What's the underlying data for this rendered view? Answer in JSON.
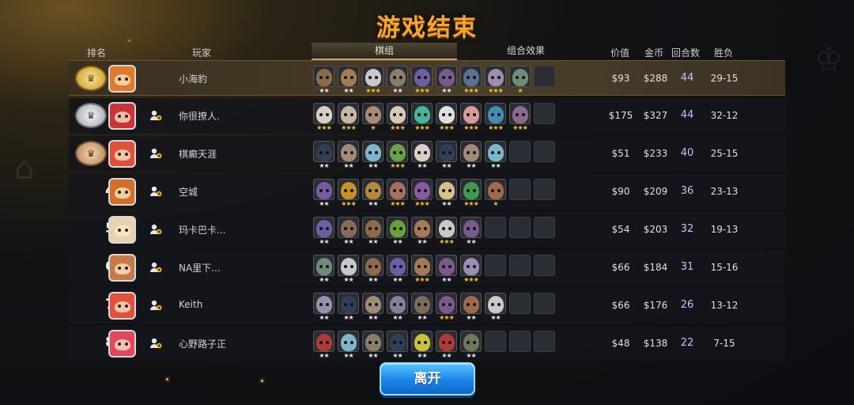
{
  "title": "游戏结束",
  "headers": {
    "rank": "排名",
    "player": "玩家",
    "pieces_tab": "棋组",
    "synergy_tab": "组合效果",
    "value": "价值",
    "gold": "金币",
    "rounds": "回合数",
    "record": "胜负"
  },
  "leave_button": "离开",
  "players": [
    {
      "rank": "",
      "medal": "gold",
      "name": "小海豹",
      "value": "$93",
      "gold": "$288",
      "rounds": "44",
      "record": "29-15",
      "avatar_color": "#e07a2e",
      "pieces": [
        {
          "color": "#8c6a4a",
          "stars": 2
        },
        {
          "color": "#a57b55",
          "stars": 2
        },
        {
          "color": "#c9c9c9",
          "stars": 3
        },
        {
          "color": "#8a7d6a",
          "stars": 2
        },
        {
          "color": "#6d5fa6",
          "stars": 3
        },
        {
          "color": "#7a5a8a",
          "stars": 2
        },
        {
          "color": "#5f6e8c",
          "stars": 3
        },
        {
          "color": "#9a8fb0",
          "stars": 3
        },
        {
          "color": "#6f8c7a",
          "stars": 1
        }
      ]
    },
    {
      "rank": "",
      "medal": "silver",
      "name": "你很撩人.",
      "value": "$175",
      "gold": "$327",
      "rounds": "44",
      "record": "32-12",
      "avatar_color": "#c9333a",
      "pieces": [
        {
          "color": "#d6d0c4",
          "stars": 3
        },
        {
          "color": "#c8b7a5",
          "stars": 3
        },
        {
          "color": "#a58a74",
          "stars": 1
        },
        {
          "color": "#d8c9b6",
          "stars": 3
        },
        {
          "color": "#45b59a",
          "stars": 3
        },
        {
          "color": "#e0e0e0",
          "stars": 3
        },
        {
          "color": "#d99a9a",
          "stars": 3
        },
        {
          "color": "#3f8fb5",
          "stars": 3
        },
        {
          "color": "#8a6a8a",
          "stars": 3
        }
      ]
    },
    {
      "rank": "",
      "medal": "bronze",
      "name": "棋癫天涯",
      "value": "$51",
      "gold": "$233",
      "rounds": "40",
      "record": "25-15",
      "avatar_color": "#e0503a",
      "pieces": [
        {
          "color": "#2f3f55",
          "stars": 2
        },
        {
          "color": "#a08a78",
          "stars": 2
        },
        {
          "color": "#7fb5c9",
          "stars": 2
        },
        {
          "color": "#6aa04a",
          "stars": 3
        },
        {
          "color": "#d9cfc4",
          "stars": 2
        },
        {
          "color": "#2f3f55",
          "stars": 2
        },
        {
          "color": "#a08a78",
          "stars": 2
        },
        {
          "color": "#7fb5c9",
          "stars": 2
        }
      ]
    },
    {
      "rank": "4",
      "medal": "",
      "name": "空城",
      "value": "$90",
      "gold": "$209",
      "rounds": "36",
      "record": "23-13",
      "avatar_color": "#d0702a",
      "pieces": [
        {
          "color": "#7a5aa0",
          "stars": 2
        },
        {
          "color": "#c9902a",
          "stars": 3
        },
        {
          "color": "#b5883a",
          "stars": 2
        },
        {
          "color": "#a57060",
          "stars": 3
        },
        {
          "color": "#8a5aa0",
          "stars": 3
        },
        {
          "color": "#d8c08a",
          "stars": 2
        },
        {
          "color": "#3f9a4a",
          "stars": 3
        },
        {
          "color": "#a06a4a",
          "stars": 1
        }
      ]
    },
    {
      "rank": "5",
      "medal": "",
      "name": "玛卡巴卡...",
      "value": "$54",
      "gold": "$203",
      "rounds": "32",
      "record": "19-13",
      "avatar_color": "#e8d2b0",
      "pieces": [
        {
          "color": "#6d5fa6",
          "stars": 2
        },
        {
          "color": "#8a6a5a",
          "stars": 2
        },
        {
          "color": "#8c6a4a",
          "stars": 2
        },
        {
          "color": "#6aa03a",
          "stars": 2
        },
        {
          "color": "#a57b55",
          "stars": 2
        },
        {
          "color": "#c9c9c9",
          "stars": 3
        },
        {
          "color": "#7a5a8a",
          "stars": 2
        }
      ]
    },
    {
      "rank": "6",
      "medal": "",
      "name": "NA里下...",
      "value": "$66",
      "gold": "$184",
      "rounds": "31",
      "record": "15-16",
      "avatar_color": "#c77a45",
      "pieces": [
        {
          "color": "#6f8c7a",
          "stars": 2
        },
        {
          "color": "#c9c9c9",
          "stars": 2
        },
        {
          "color": "#8c6a4a",
          "stars": 2
        },
        {
          "color": "#6d5fa6",
          "stars": 2
        },
        {
          "color": "#a57b55",
          "stars": 3
        },
        {
          "color": "#7a5a8a",
          "stars": 2
        },
        {
          "color": "#9a8fb0",
          "stars": 3
        }
      ]
    },
    {
      "rank": "7",
      "medal": "",
      "name": "Keith",
      "value": "$66",
      "gold": "$176",
      "rounds": "26",
      "record": "13-12",
      "avatar_color": "#e0503a",
      "pieces": [
        {
          "color": "#9a8fb0",
          "stars": 2
        },
        {
          "color": "#2f3f55",
          "stars": 2
        },
        {
          "color": "#a08a78",
          "stars": 2
        },
        {
          "color": "#8a7d9a",
          "stars": 2
        },
        {
          "color": "#7a6a5a",
          "stars": 2
        },
        {
          "color": "#7a5a8a",
          "stars": 3
        },
        {
          "color": "#a06a4a",
          "stars": 2
        },
        {
          "color": "#c9c9c9",
          "stars": 2
        }
      ]
    },
    {
      "rank": "8",
      "medal": "",
      "name": "心野路子正",
      "value": "$48",
      "gold": "$138",
      "rounds": "22",
      "record": "7-15",
      "avatar_color": "#e04860",
      "pieces": [
        {
          "color": "#b03a3a",
          "stars": 2
        },
        {
          "color": "#7fb5c9",
          "stars": 2
        },
        {
          "color": "#8a7d6a",
          "stars": 2
        },
        {
          "color": "#2f3f55",
          "stars": 2
        },
        {
          "color": "#c9c23a",
          "stars": 2
        },
        {
          "color": "#b03a3a",
          "stars": 2
        },
        {
          "color": "#6a7a5a",
          "stars": 2
        }
      ]
    }
  ]
}
